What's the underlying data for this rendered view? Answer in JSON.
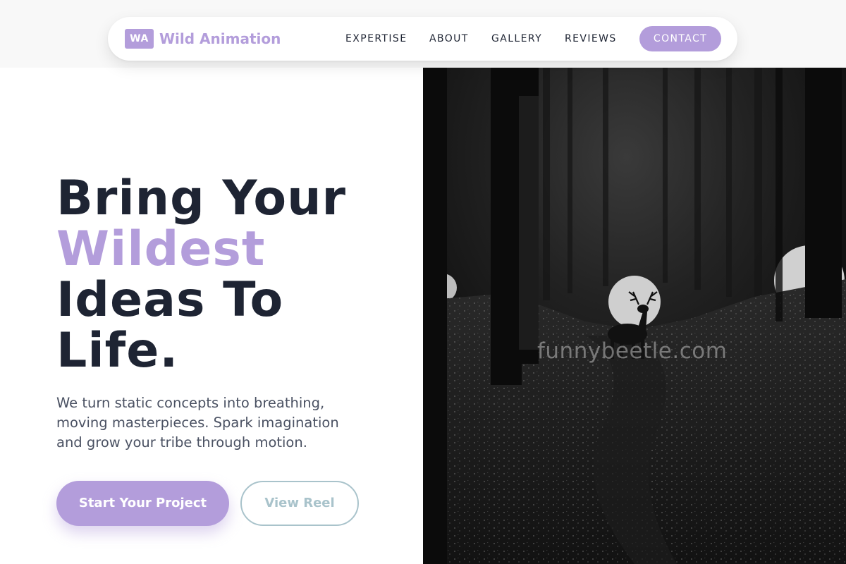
{
  "brand": {
    "badge": "WA",
    "name": "Wild Animation",
    "accent_color": "#b39ddb"
  },
  "nav": {
    "links": [
      "EXPERTISE",
      "ABOUT",
      "GALLERY",
      "REVIEWS"
    ],
    "contact_label": "CONTACT"
  },
  "hero": {
    "title_line1": "Bring Your",
    "title_accent": "Wildest",
    "title_line3": "Ideas To",
    "title_line4": "Life.",
    "subtitle": "We turn static concepts into breathing, moving masterpieces. Spark imagination and grow your tribe through motion.",
    "primary_cta": "Start Your Project",
    "secondary_cta": "View Reel"
  },
  "image": {
    "subject": "deer-in-dark-forest",
    "watermark": "funnybeetle.com"
  }
}
